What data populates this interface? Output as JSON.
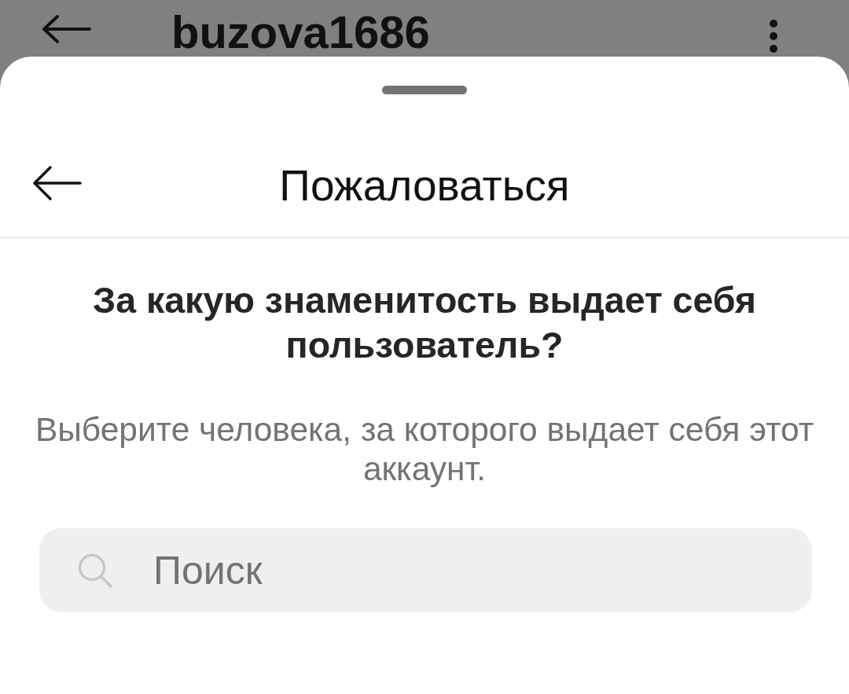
{
  "top_bar": {
    "title": "buzova1686"
  },
  "sheet": {
    "title": "Пожаловаться",
    "question": "За какую знаменитость выдает себя пользователь?",
    "description": "Выберите человека, за которого выдает себя этот аккаунт.",
    "search": {
      "placeholder": "Поиск"
    }
  }
}
